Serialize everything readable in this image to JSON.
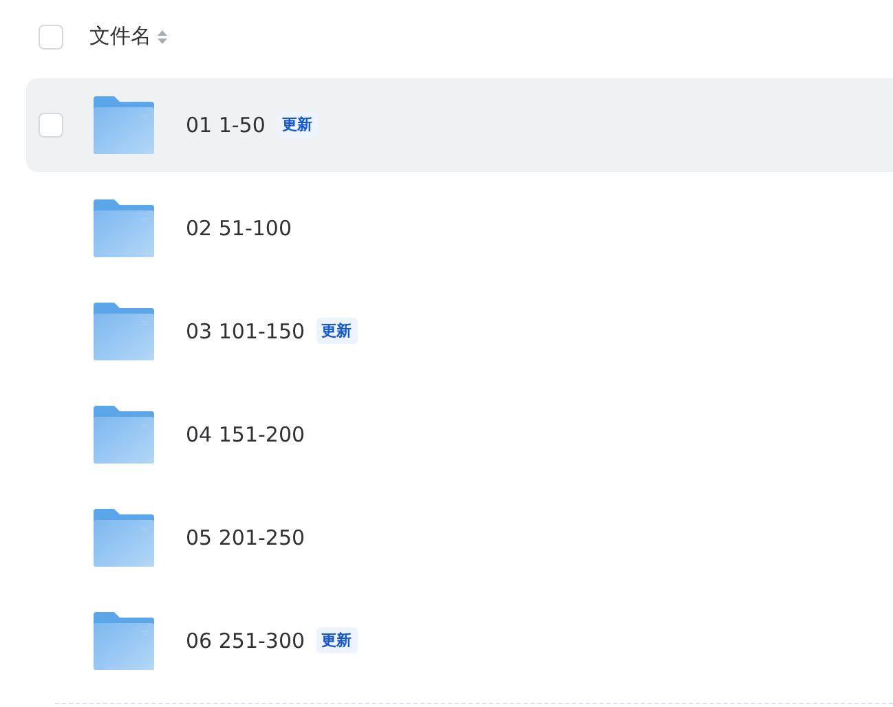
{
  "header": {
    "checked": false,
    "label": "文件名"
  },
  "rows": [
    {
      "name": "01 1-50",
      "badge": "更新",
      "hovered": true,
      "checked": false
    },
    {
      "name": "02 51-100",
      "hovered": false,
      "checked": false
    },
    {
      "name": "03 101-150",
      "badge": "更新",
      "hovered": false,
      "checked": false
    },
    {
      "name": "04 151-200",
      "hovered": false,
      "checked": false
    },
    {
      "name": "05 201-250",
      "hovered": false,
      "checked": false
    },
    {
      "name": "06 251-300",
      "badge": "更新",
      "hovered": false,
      "checked": false
    }
  ]
}
